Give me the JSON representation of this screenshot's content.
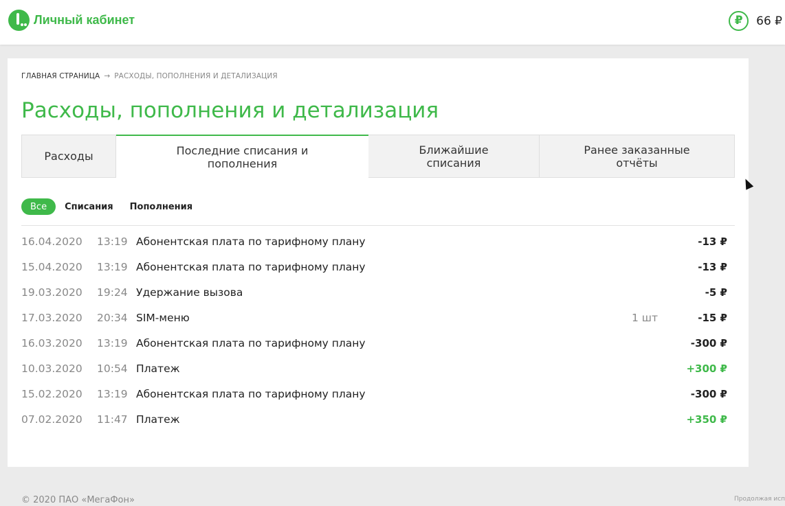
{
  "header": {
    "logo_text": "Личный кабинет",
    "balance": "66 ₽",
    "balance_icon": "ruble-circle-icon",
    "accent_color": "#3fb94a"
  },
  "breadcrumb": {
    "home": "ГЛАВНАЯ СТРАНИЦА",
    "separator": "→",
    "current": "РАСХОДЫ, ПОПОЛНЕНИЯ И ДЕТАЛИЗАЦИЯ"
  },
  "page_title": "Расходы, пополнения и детализация",
  "tabs": [
    {
      "label_line1": "Расходы",
      "label_line2": "",
      "active": false
    },
    {
      "label_line1": "Последние списания и",
      "label_line2": "пополнения",
      "active": true
    },
    {
      "label_line1": "Ближайшие",
      "label_line2": "списания",
      "active": false
    },
    {
      "label_line1": "Ранее заказанные",
      "label_line2": "отчёты",
      "active": false
    }
  ],
  "filters": {
    "all": "Все",
    "charges": "Списания",
    "topups": "Пополнения",
    "selected": "all"
  },
  "transactions": [
    {
      "date": "16.04.2020",
      "time": "13:19",
      "description": "Абонентская плата по тарифному плану",
      "qty": "",
      "amount": "-13 ₽"
    },
    {
      "date": "15.04.2020",
      "time": "13:19",
      "description": "Абонентская плата по тарифному плану",
      "qty": "",
      "amount": "-13 ₽"
    },
    {
      "date": "19.03.2020",
      "time": "19:24",
      "description": "Удержание вызова",
      "qty": "",
      "amount": "-5 ₽"
    },
    {
      "date": "17.03.2020",
      "time": "20:34",
      "description": "SIM-меню",
      "qty": "1 шт",
      "amount": "-15 ₽"
    },
    {
      "date": "16.03.2020",
      "time": "13:19",
      "description": "Абонентская плата по тарифному плану",
      "qty": "",
      "amount": "-300 ₽"
    },
    {
      "date": "10.03.2020",
      "time": "10:54",
      "description": "Платеж",
      "qty": "",
      "amount": "+300 ₽"
    },
    {
      "date": "15.02.2020",
      "time": "13:19",
      "description": "Абонентская плата по тарифному плану",
      "qty": "",
      "amount": "-300 ₽"
    },
    {
      "date": "07.02.2020",
      "time": "11:47",
      "description": "Платеж",
      "qty": "",
      "amount": "+350 ₽"
    }
  ],
  "footer": {
    "copyright": "© 2020 ПАО «МегаФон»",
    "note": "Продолжая испо"
  }
}
